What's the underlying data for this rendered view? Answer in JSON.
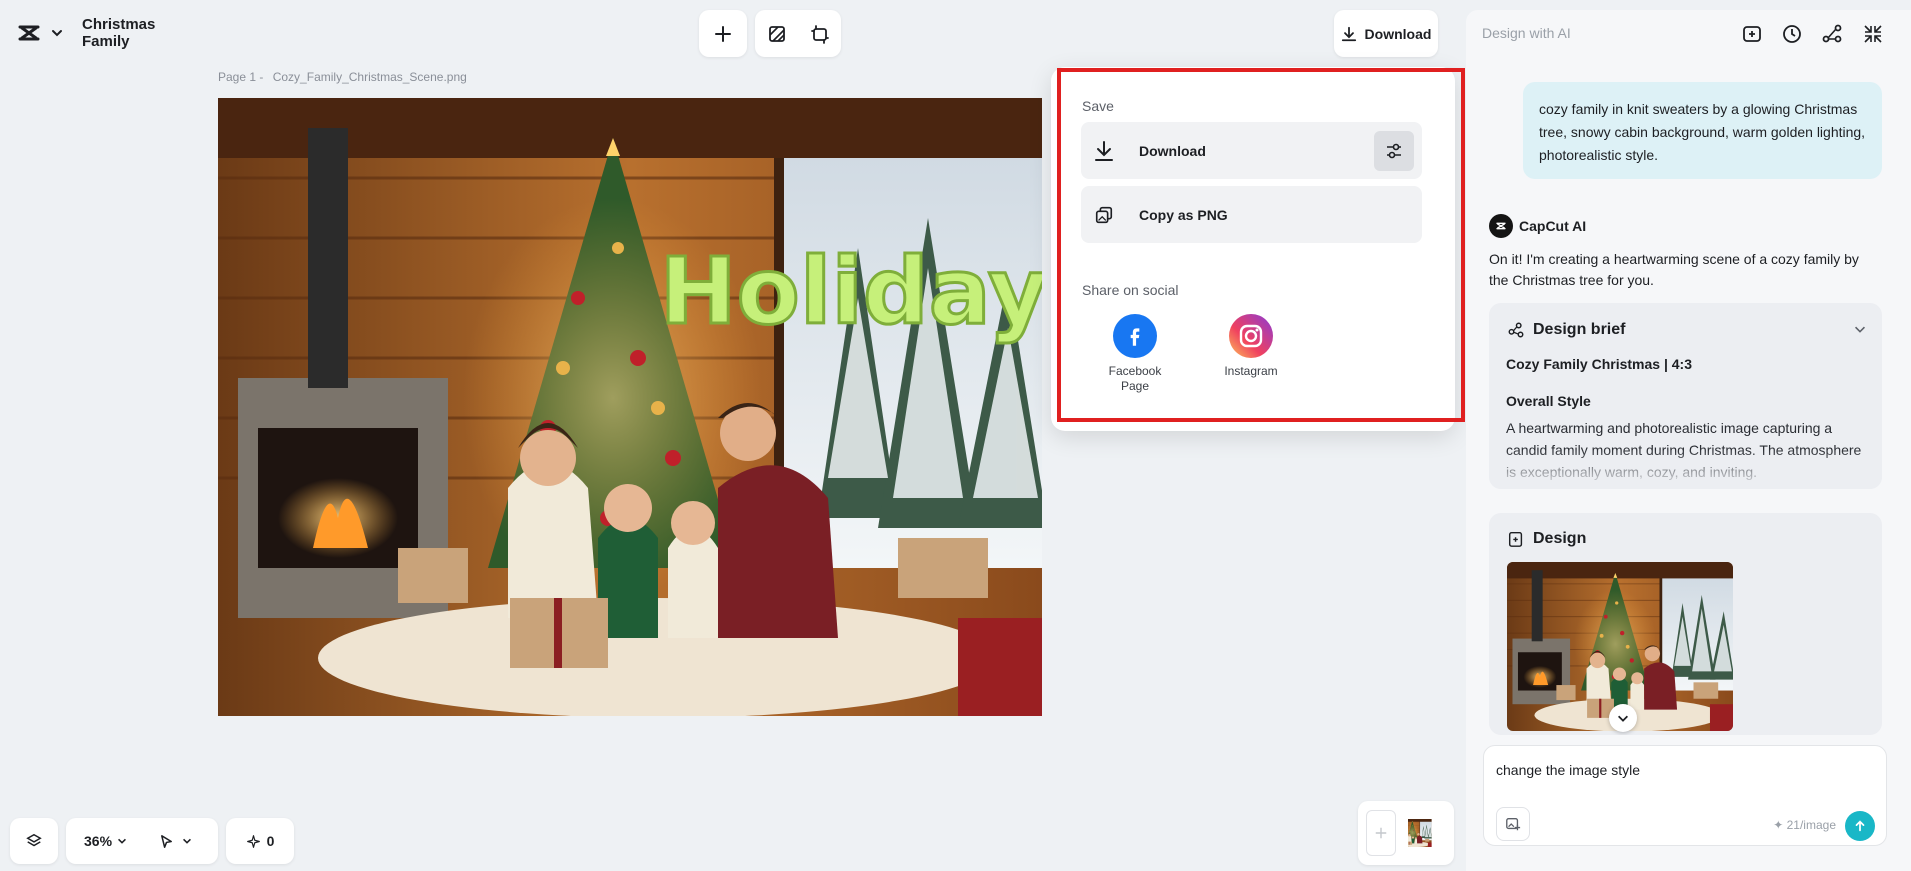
{
  "app": {
    "project_title": "Christmas Family"
  },
  "toolbar": {
    "download_label": "Download"
  },
  "canvas": {
    "page_prefix": "Page 1 -",
    "file_name": "Cozy_Family_Christmas_Scene.png",
    "overlay_text": "Holiday"
  },
  "popup": {
    "save_heading": "Save",
    "download_label": "Download",
    "copy_png_label": "Copy as PNG",
    "share_heading": "Share on social",
    "socials": [
      {
        "label_line1": "Facebook",
        "label_line2": "Page",
        "icon": "facebook-icon",
        "color": "#1877f2"
      },
      {
        "label_line1": "Instagram",
        "label_line2": "",
        "icon": "instagram-icon"
      }
    ],
    "highlight_color": "#e02020"
  },
  "panel": {
    "title": "Design with AI",
    "user_message": "cozy family in knit sweaters by a glowing Christmas tree, snowy cabin background, warm golden lighting, photorealistic style.",
    "ai_name": "CapCut AI",
    "ai_message": "On it! I'm creating a heartwarming scene of a cozy family by the Christmas tree for you.",
    "brief": {
      "title": "Design brief",
      "subtitle": "Cozy Family Christmas | 4:3",
      "style_heading": "Overall Style",
      "style_text": "A heartwarming and photorealistic image capturing a candid family moment during Christmas. The atmosphere is exceptionally warm, cozy, and inviting."
    },
    "design_title": "Design",
    "chat_input_value": "change the image style",
    "credit_text": "21/image",
    "accent": "#19b7c7"
  },
  "bottom": {
    "zoom": "36%",
    "ai_count": "0"
  }
}
